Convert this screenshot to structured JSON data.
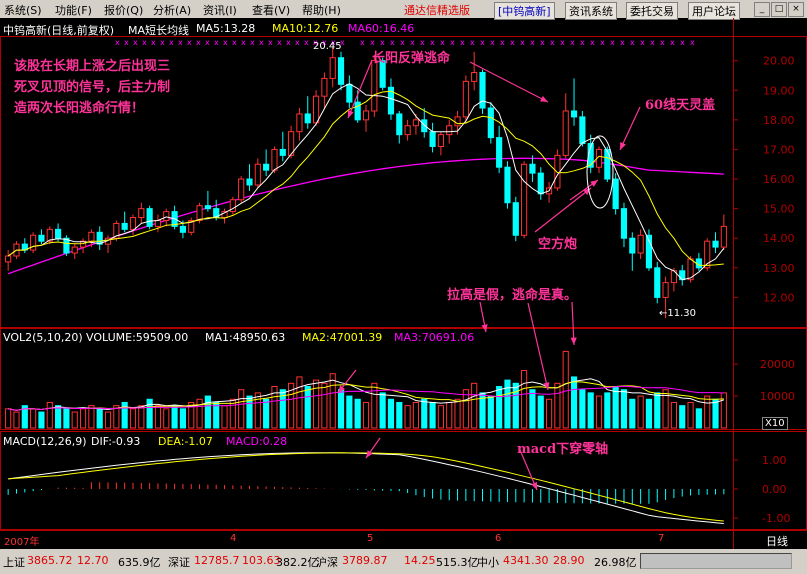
{
  "menu": {
    "items": [
      "系统(S)",
      "功能(F)",
      "报价(Q)",
      "分析(A)",
      "资讯(I)",
      "查看(V)",
      "帮助(H)"
    ],
    "brand": "通达信精选版",
    "stock_tag": "[中钨高新]",
    "buttons": [
      "资讯系统",
      "委托交易",
      "用户论坛"
    ],
    "window_buttons": [
      "_",
      "□",
      "×"
    ]
  },
  "price_panel": {
    "header": {
      "title": "中钨高新(日线,前复权)",
      "indicator": "MA短长均线",
      "ma5": "MA5:13.28",
      "ma10": "MA10:12.76",
      "ma60": "MA60:16.46"
    },
    "high_label": "20.45",
    "low_label": "←11.30",
    "y_ticks": [
      20,
      19,
      18,
      17,
      16,
      15,
      14,
      13,
      12
    ]
  },
  "volume_panel": {
    "header": {
      "name": "VOL2(5,10,20)",
      "volume": "VOLUME:59509.00",
      "ma1": "MA1:48950.63",
      "ma2": "MA2:47001.39",
      "ma3": "MA3:70691.06"
    },
    "y_ticks": [
      "20000",
      "10000"
    ],
    "unit": "X10"
  },
  "macd_panel": {
    "header": {
      "name": "MACD(12,26,9)",
      "dif": "DIF:-0.93",
      "dea": "DEA:-1.07",
      "macd": "MACD:0.28"
    },
    "y_ticks": [
      "1.00",
      "0.00",
      "-1.00"
    ]
  },
  "x_axis": {
    "labels": [
      "2007年",
      "4",
      "5",
      "6",
      "7"
    ],
    "period": "日线"
  },
  "annotations": {
    "top_left": [
      "该股在长期上涨之后出现三",
      "死叉见顶的信号，后主力制",
      "造两次长阳逃命行情！"
    ],
    "rebound": "长阳反弹逃命",
    "ma60_cover": "60线天灵盖",
    "empty_cannon": "空方炮",
    "fake_rise": "拉高是假，逃命是真。",
    "macd_cross": "macd下穿零轴"
  },
  "status_bar": {
    "items": [
      {
        "label": "上证",
        "value": "3865.72",
        "change": "12.70",
        "amount": "635.9亿"
      },
      {
        "label": "深证",
        "value": "12785.7",
        "change": "103.63",
        "amount": "382.2亿"
      },
      {
        "label": "沪深",
        "value": "3789.87",
        "change": "14.25",
        "amount": "515.3亿"
      },
      {
        "label": "中小",
        "value": "4341.30",
        "change": "28.90",
        "amount": "26.98亿"
      }
    ]
  },
  "colors": {
    "up": "#ff3232",
    "down": "#00ffff",
    "ma5": "#ffffff",
    "ma10": "#ffff00",
    "ma60": "#ff00ff",
    "annotation": "#ff3399",
    "axis": "#b00000"
  },
  "chart_data": {
    "type": "candlestick",
    "title": "中钨高新(日线,前复权)",
    "price_range": [
      11.0,
      20.8
    ],
    "candles": [
      [
        13.2,
        13.6,
        12.9,
        13.4
      ],
      [
        13.4,
        13.9,
        13.3,
        13.8
      ],
      [
        13.8,
        14.0,
        13.5,
        13.6
      ],
      [
        13.6,
        14.2,
        13.5,
        14.1
      ],
      [
        14.1,
        14.3,
        13.8,
        13.9
      ],
      [
        13.9,
        14.4,
        13.8,
        14.3
      ],
      [
        14.3,
        14.5,
        13.9,
        14.0
      ],
      [
        14.0,
        14.1,
        13.4,
        13.5
      ],
      [
        13.5,
        13.8,
        13.3,
        13.7
      ],
      [
        13.7,
        14.0,
        13.5,
        13.9
      ],
      [
        13.9,
        14.3,
        13.7,
        14.2
      ],
      [
        14.2,
        14.4,
        13.6,
        13.8
      ],
      [
        13.8,
        14.1,
        13.5,
        14.0
      ],
      [
        14.0,
        14.6,
        13.9,
        14.5
      ],
      [
        14.5,
        14.9,
        14.2,
        14.3
      ],
      [
        14.3,
        14.8,
        14.1,
        14.7
      ],
      [
        14.7,
        15.2,
        14.5,
        15.0
      ],
      [
        15.0,
        15.1,
        14.3,
        14.4
      ],
      [
        14.4,
        14.8,
        14.2,
        14.6
      ],
      [
        14.6,
        15.0,
        14.4,
        14.9
      ],
      [
        14.9,
        15.1,
        14.3,
        14.4
      ],
      [
        14.4,
        14.6,
        14.0,
        14.2
      ],
      [
        14.2,
        14.7,
        14.1,
        14.6
      ],
      [
        14.6,
        15.2,
        14.5,
        15.1
      ],
      [
        15.1,
        15.6,
        14.9,
        15.0
      ],
      [
        15.0,
        15.3,
        14.6,
        14.7
      ],
      [
        14.7,
        15.0,
        14.5,
        14.9
      ],
      [
        14.9,
        15.4,
        14.8,
        15.3
      ],
      [
        15.3,
        16.1,
        15.2,
        16.0
      ],
      [
        16.0,
        16.5,
        15.6,
        15.8
      ],
      [
        15.8,
        16.7,
        15.7,
        16.5
      ],
      [
        16.5,
        17.0,
        16.1,
        16.3
      ],
      [
        16.3,
        17.1,
        16.2,
        17.0
      ],
      [
        17.0,
        17.6,
        16.6,
        16.8
      ],
      [
        16.8,
        17.8,
        16.7,
        17.6
      ],
      [
        17.6,
        18.4,
        17.3,
        18.2
      ],
      [
        18.2,
        18.8,
        17.7,
        17.9
      ],
      [
        17.9,
        19.0,
        17.8,
        18.8
      ],
      [
        18.8,
        19.6,
        18.4,
        19.4
      ],
      [
        19.4,
        20.45,
        19.1,
        20.1
      ],
      [
        20.1,
        20.3,
        19.0,
        19.2
      ],
      [
        19.2,
        19.5,
        18.4,
        18.6
      ],
      [
        18.6,
        19.0,
        17.9,
        18.0
      ],
      [
        18.0,
        18.5,
        17.6,
        18.3
      ],
      [
        18.3,
        20.2,
        18.1,
        20.0
      ],
      [
        20.0,
        20.1,
        19.0,
        19.1
      ],
      [
        19.1,
        19.4,
        18.0,
        18.2
      ],
      [
        18.2,
        18.3,
        17.2,
        17.5
      ],
      [
        17.5,
        18.0,
        17.3,
        17.8
      ],
      [
        17.8,
        18.2,
        17.5,
        18.0
      ],
      [
        18.0,
        18.4,
        17.4,
        17.6
      ],
      [
        17.6,
        17.9,
        16.9,
        17.1
      ],
      [
        17.1,
        17.6,
        16.8,
        17.5
      ],
      [
        17.5,
        18.0,
        17.2,
        17.8
      ],
      [
        17.8,
        18.3,
        17.5,
        18.1
      ],
      [
        18.1,
        19.5,
        17.9,
        19.3
      ],
      [
        19.3,
        20.3,
        19.0,
        19.6
      ],
      [
        19.6,
        19.7,
        18.2,
        18.4
      ],
      [
        18.4,
        18.6,
        17.2,
        17.4
      ],
      [
        17.4,
        17.8,
        16.2,
        16.4
      ],
      [
        16.4,
        16.6,
        15.0,
        15.2
      ],
      [
        15.2,
        15.4,
        13.9,
        14.1
      ],
      [
        14.1,
        16.6,
        14.0,
        16.5
      ],
      [
        16.5,
        16.8,
        15.9,
        16.2
      ],
      [
        16.2,
        16.4,
        15.3,
        15.5
      ],
      [
        15.5,
        15.9,
        15.2,
        15.7
      ],
      [
        15.7,
        17.0,
        15.6,
        16.8
      ],
      [
        16.8,
        18.9,
        16.7,
        18.3
      ],
      [
        18.3,
        19.4,
        17.8,
        18.1
      ],
      [
        18.1,
        18.3,
        17.1,
        17.2
      ],
      [
        17.2,
        17.5,
        16.2,
        16.4
      ],
      [
        16.4,
        17.1,
        16.2,
        17.0
      ],
      [
        17.0,
        17.1,
        15.9,
        16.0
      ],
      [
        16.0,
        16.2,
        14.8,
        15.0
      ],
      [
        15.0,
        15.2,
        13.7,
        14.0
      ],
      [
        14.0,
        14.2,
        12.9,
        13.5
      ],
      [
        13.5,
        14.3,
        13.3,
        14.1
      ],
      [
        14.1,
        14.3,
        12.9,
        13.0
      ],
      [
        13.0,
        13.2,
        11.8,
        12.0
      ],
      [
        12.0,
        12.7,
        11.3,
        12.5
      ],
      [
        12.5,
        13.0,
        12.2,
        12.9
      ],
      [
        12.9,
        13.1,
        12.4,
        12.6
      ],
      [
        12.6,
        13.4,
        12.5,
        13.3
      ],
      [
        13.3,
        13.5,
        12.9,
        13.0
      ],
      [
        13.0,
        14.0,
        12.9,
        13.9
      ],
      [
        13.9,
        14.2,
        13.5,
        13.7
      ],
      [
        13.7,
        14.8,
        13.6,
        14.4
      ]
    ],
    "volume": [
      6,
      5,
      7,
      6,
      5,
      8,
      7,
      6,
      5,
      6,
      7,
      6,
      5,
      7,
      8,
      6,
      7,
      9,
      7,
      6,
      7,
      6,
      8,
      9,
      10,
      8,
      7,
      9,
      12,
      10,
      11,
      9,
      13,
      12,
      14,
      16,
      13,
      15,
      14,
      17,
      12,
      10,
      9,
      8,
      14,
      11,
      9,
      8,
      7,
      8,
      9,
      8,
      7,
      8,
      9,
      12,
      14,
      11,
      10,
      13,
      15,
      14,
      18,
      12,
      10,
      9,
      14,
      24,
      16,
      12,
      11,
      10,
      11,
      13,
      12,
      9,
      10,
      9,
      11,
      12,
      8,
      7,
      8,
      6,
      10,
      9,
      11
    ],
    "ma_labels": {
      "ma5": "MA5:13.28",
      "ma10": "MA10:12.76",
      "ma60": "MA60:16.46"
    }
  }
}
